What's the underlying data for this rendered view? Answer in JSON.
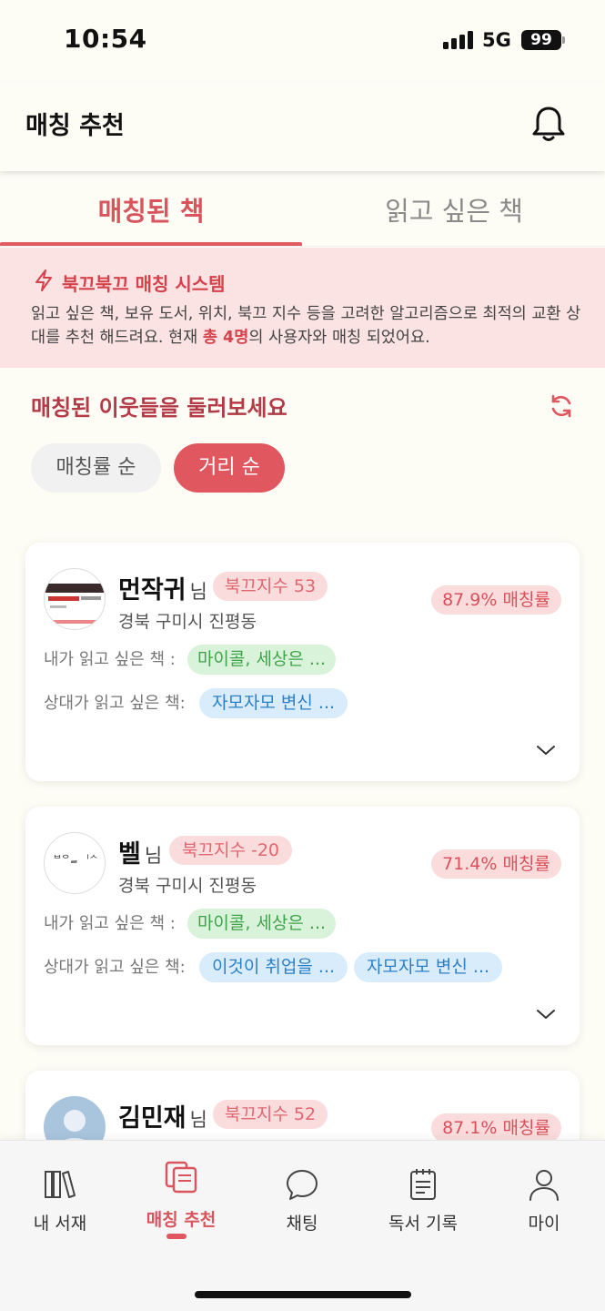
{
  "status_bar": {
    "time": "10:54",
    "network": "5G",
    "battery": "99"
  },
  "header": {
    "title": "매칭 추천"
  },
  "tabs": [
    {
      "label": "매칭된 책",
      "active": true
    },
    {
      "label": "읽고 싶은 책",
      "active": false
    }
  ],
  "info": {
    "title": "북끄북끄 매칭 시스템",
    "text_before": "읽고 싶은 책, 보유 도서, 위치, 북끄 지수 등을 고려한 알고리즘으로 최적의 교환 상대를 추천 해드려요. 현재 ",
    "highlight": "총 4명",
    "text_after": "의 사용자와 매칭 되었어요."
  },
  "section": {
    "title": "매칭된 이웃들을 둘러보세요"
  },
  "sort_chips": [
    {
      "label": "매칭률 순",
      "active": false
    },
    {
      "label": "거리 순",
      "active": true
    }
  ],
  "labels": {
    "my_wish": "내가 읽고 싶은 책 :",
    "their_wish": "상대가 읽고 싶은 책:",
    "honorific": "님"
  },
  "cards": [
    {
      "name": "먼작귀",
      "score": "북끄지수 53",
      "location": "경북 구미시 진평동",
      "rate": "87.9% 매칭률",
      "my_wish_books": [
        "마이콜, 세상은 ..."
      ],
      "their_wish_books": [
        "자모자모 변신 ..."
      ]
    },
    {
      "name": "벨",
      "score": "북끄지수 -20",
      "location": "경북 구미시 진평동",
      "rate": "71.4% 매칭률",
      "my_wish_books": [
        "마이콜, 세상은 ..."
      ],
      "their_wish_books": [
        "이것이 취업을 ...",
        "자모자모 변신 ..."
      ]
    },
    {
      "name": "김민재",
      "score": "북끄지수 52",
      "rate": "87.1% 매칭률"
    }
  ],
  "bottom_nav": [
    {
      "label": "내 서재",
      "icon": "bookshelf-icon"
    },
    {
      "label": "매칭 추천",
      "icon": "match-books-icon",
      "active": true
    },
    {
      "label": "채팅",
      "icon": "chat-bubble-icon"
    },
    {
      "label": "독서 기록",
      "icon": "notepad-icon"
    },
    {
      "label": "마이",
      "icon": "person-icon"
    }
  ],
  "colors": {
    "accent": "#e0575f",
    "background": "#fdfcf5",
    "info_bg": "#fbe3e3",
    "green_tag": "#d9f2da",
    "blue_tag": "#d9ecfb"
  }
}
